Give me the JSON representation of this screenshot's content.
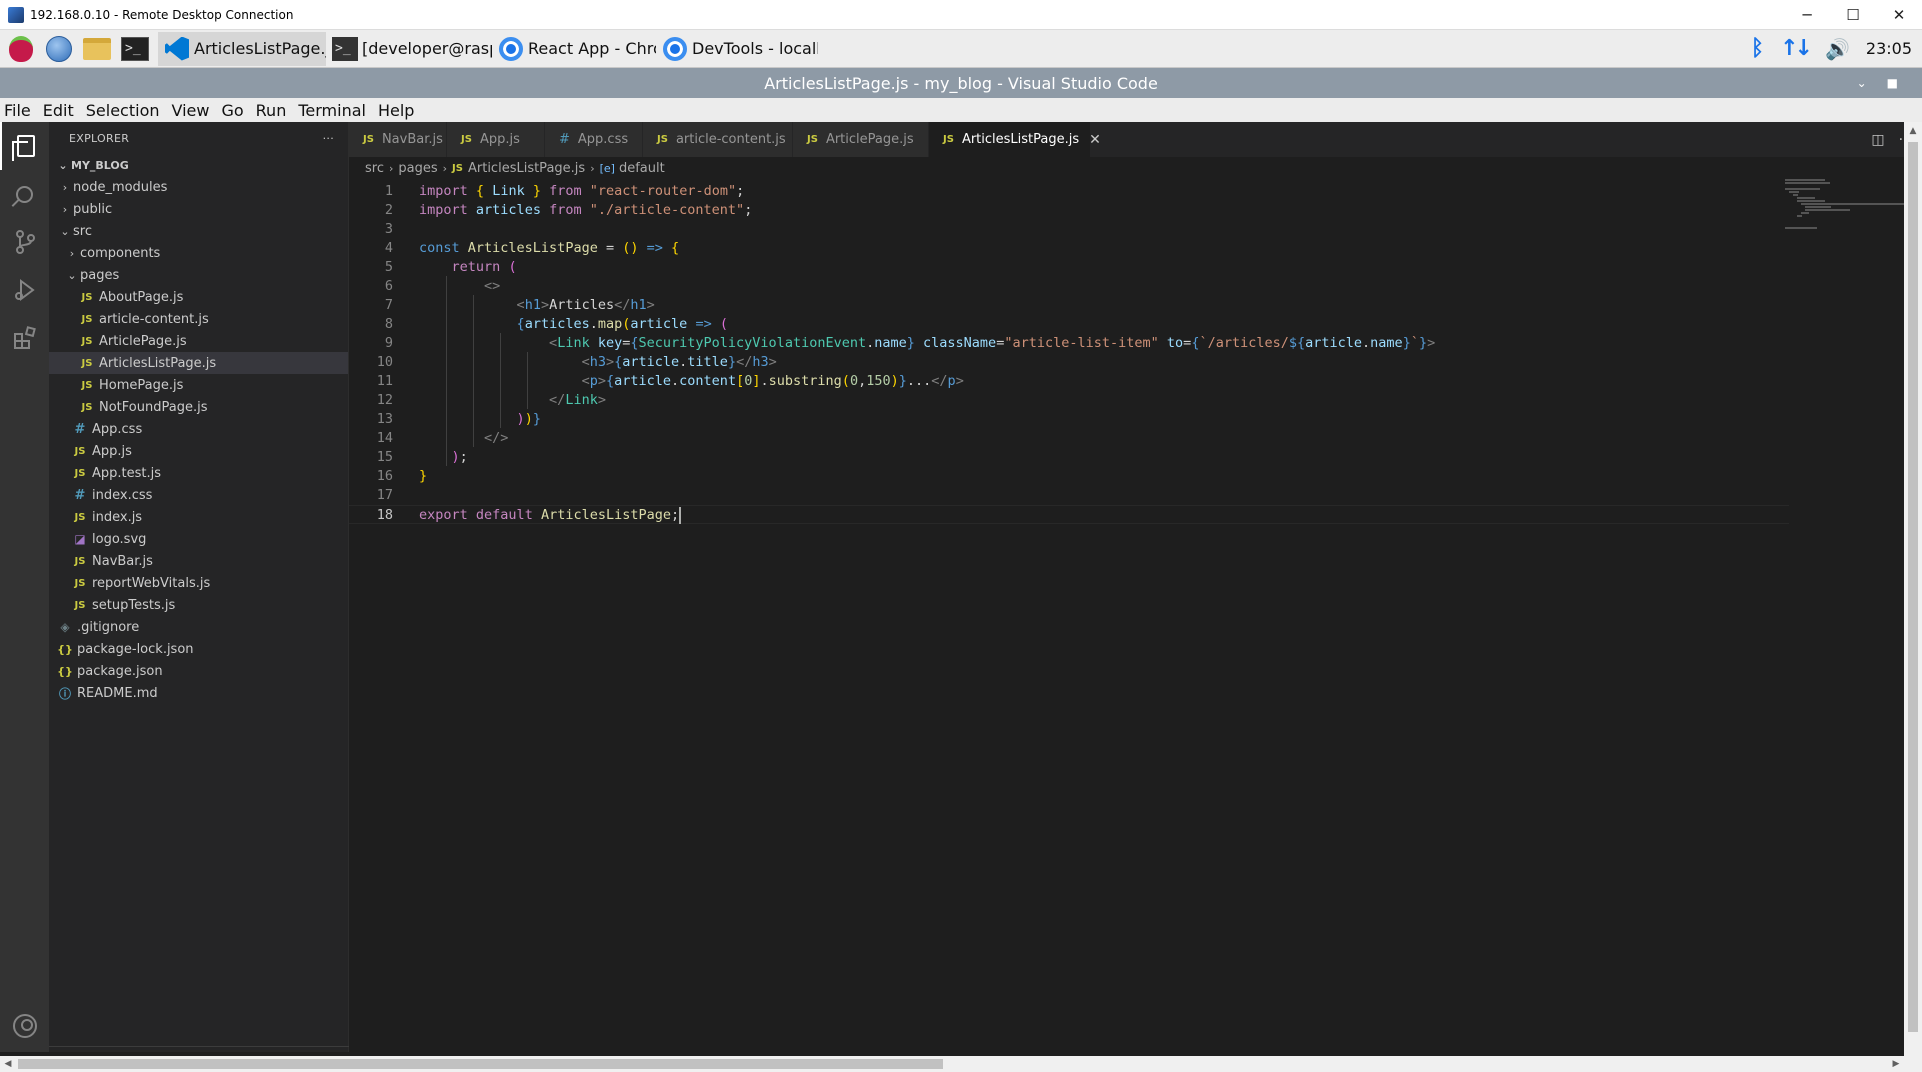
{
  "rdp": {
    "title": "192.168.0.10 - Remote Desktop Connection",
    "minimize": "─",
    "maximize": "☐",
    "close": "✕"
  },
  "taskbar": {
    "tasks": [
      {
        "label": "ArticlesListPage.js - ...",
        "icon": "vscode-icon",
        "active": true
      },
      {
        "label": "[developer@raspberr...",
        "icon": "terminal-icon",
        "active": false
      },
      {
        "label": "React App - Chromium",
        "icon": "chromium-icon",
        "active": false
      },
      {
        "label": "DevTools - localhost:...",
        "icon": "chromium-icon",
        "active": false
      }
    ],
    "clock": "23:05"
  },
  "window": {
    "title": "ArticlesListPage.js - my_blog - Visual Studio Code"
  },
  "menu": [
    "File",
    "Edit",
    "Selection",
    "View",
    "Go",
    "Run",
    "Terminal",
    "Help"
  ],
  "sidebar": {
    "title": "EXPLORER",
    "more": "···",
    "root": "MY_BLOG",
    "items": [
      {
        "label": "node_modules",
        "type": "folder",
        "open": false,
        "depth": 1
      },
      {
        "label": "public",
        "type": "folder",
        "open": false,
        "depth": 1
      },
      {
        "label": "src",
        "type": "folder",
        "open": true,
        "depth": 1
      },
      {
        "label": "components",
        "type": "folder",
        "open": false,
        "depth": 2
      },
      {
        "label": "pages",
        "type": "folder",
        "open": true,
        "depth": 2
      },
      {
        "label": "AboutPage.js",
        "type": "js",
        "depth": 3
      },
      {
        "label": "article-content.js",
        "type": "js",
        "depth": 3
      },
      {
        "label": "ArticlePage.js",
        "type": "js",
        "depth": 3
      },
      {
        "label": "ArticlesListPage.js",
        "type": "js",
        "depth": 3,
        "selected": true
      },
      {
        "label": "HomePage.js",
        "type": "js",
        "depth": 3
      },
      {
        "label": "NotFoundPage.js",
        "type": "js",
        "depth": 3
      },
      {
        "label": "App.css",
        "type": "css",
        "depth": 2
      },
      {
        "label": "App.js",
        "type": "js",
        "depth": 2
      },
      {
        "label": "App.test.js",
        "type": "js",
        "depth": 2
      },
      {
        "label": "index.css",
        "type": "css",
        "depth": 2
      },
      {
        "label": "index.js",
        "type": "js",
        "depth": 2
      },
      {
        "label": "logo.svg",
        "type": "svg",
        "depth": 2
      },
      {
        "label": "NavBar.js",
        "type": "js",
        "depth": 2
      },
      {
        "label": "reportWebVitals.js",
        "type": "js",
        "depth": 2
      },
      {
        "label": "setupTests.js",
        "type": "js",
        "depth": 2
      },
      {
        "label": ".gitignore",
        "type": "git",
        "depth": 1
      },
      {
        "label": "package-lock.json",
        "type": "json",
        "depth": 1
      },
      {
        "label": "package.json",
        "type": "json",
        "depth": 1
      },
      {
        "label": "README.md",
        "type": "md",
        "depth": 1
      }
    ]
  },
  "tabs": [
    {
      "label": "NavBar.js",
      "type": "js"
    },
    {
      "label": "App.js",
      "type": "js"
    },
    {
      "label": "App.css",
      "type": "css"
    },
    {
      "label": "article-content.js",
      "type": "js"
    },
    {
      "label": "ArticlePage.js",
      "type": "js"
    },
    {
      "label": "ArticlesListPage.js",
      "type": "js",
      "active": true
    }
  ],
  "breadcrumb": {
    "parts": [
      "src",
      "pages",
      "ArticlesListPage.js"
    ],
    "symbol": "default"
  },
  "editor": {
    "current_line": 18,
    "lines": [
      [
        [
          "kw",
          "import"
        ],
        [
          "p",
          " "
        ],
        [
          "br1",
          "{"
        ],
        [
          "p",
          " "
        ],
        [
          "var",
          "Link"
        ],
        [
          "p",
          " "
        ],
        [
          "br1",
          "}"
        ],
        [
          "p",
          " "
        ],
        [
          "kw",
          "from"
        ],
        [
          "p",
          " "
        ],
        [
          "str",
          "\"react-router-dom\""
        ],
        [
          "p",
          ";"
        ]
      ],
      [
        [
          "kw",
          "import"
        ],
        [
          "p",
          " "
        ],
        [
          "var",
          "articles"
        ],
        [
          "p",
          " "
        ],
        [
          "kw",
          "from"
        ],
        [
          "p",
          " "
        ],
        [
          "str",
          "\"./article-content\""
        ],
        [
          "p",
          ";"
        ]
      ],
      [],
      [
        [
          "kb",
          "const"
        ],
        [
          "p",
          " "
        ],
        [
          "fn",
          "ArticlesListPage"
        ],
        [
          "p",
          " = "
        ],
        [
          "br1",
          "()"
        ],
        [
          "p",
          " "
        ],
        [
          "kb",
          "=>"
        ],
        [
          "p",
          " "
        ],
        [
          "br1",
          "{"
        ]
      ],
      [
        [
          "p",
          "    "
        ],
        [
          "kw",
          "return"
        ],
        [
          "p",
          " "
        ],
        [
          "br2",
          "("
        ]
      ],
      [
        [
          "p",
          "        "
        ],
        [
          "tagb",
          "<>"
        ]
      ],
      [
        [
          "p",
          "            "
        ],
        [
          "tagb",
          "<"
        ],
        [
          "tag",
          "h1"
        ],
        [
          "tagb",
          ">"
        ],
        [
          "p",
          "Articles"
        ],
        [
          "tagb",
          "</"
        ],
        [
          "tag",
          "h1"
        ],
        [
          "tagb",
          ">"
        ]
      ],
      [
        [
          "p",
          "            "
        ],
        [
          "kb",
          "{"
        ],
        [
          "var",
          "articles"
        ],
        [
          "p",
          "."
        ],
        [
          "fn",
          "map"
        ],
        [
          "br1",
          "("
        ],
        [
          "var",
          "article"
        ],
        [
          "p",
          " "
        ],
        [
          "kb",
          "=>"
        ],
        [
          "p",
          " "
        ],
        [
          "br2",
          "("
        ]
      ],
      [
        [
          "p",
          "                "
        ],
        [
          "tagb",
          "<"
        ],
        [
          "typ",
          "Link"
        ],
        [
          "p",
          " "
        ],
        [
          "attr",
          "key"
        ],
        [
          "p",
          "="
        ],
        [
          "kb",
          "{"
        ],
        [
          "typ",
          "SecurityPolicyViolationEvent"
        ],
        [
          "p",
          "."
        ],
        [
          "var",
          "name"
        ],
        [
          "kb",
          "}"
        ],
        [
          "p",
          " "
        ],
        [
          "attr",
          "className"
        ],
        [
          "p",
          "="
        ],
        [
          "str",
          "\"article-list-item\""
        ],
        [
          "p",
          " "
        ],
        [
          "attr",
          "to"
        ],
        [
          "p",
          "="
        ],
        [
          "kb",
          "{"
        ],
        [
          "str",
          "`/articles/"
        ],
        [
          "kb",
          "${"
        ],
        [
          "var",
          "article"
        ],
        [
          "p",
          "."
        ],
        [
          "var",
          "name"
        ],
        [
          "kb",
          "}"
        ],
        [
          "str",
          "`"
        ],
        [
          "kb",
          "}"
        ],
        [
          "tagb",
          ">"
        ]
      ],
      [
        [
          "p",
          "                    "
        ],
        [
          "tagb",
          "<"
        ],
        [
          "tag",
          "h3"
        ],
        [
          "tagb",
          ">"
        ],
        [
          "kb",
          "{"
        ],
        [
          "var",
          "article"
        ],
        [
          "p",
          "."
        ],
        [
          "var",
          "title"
        ],
        [
          "kb",
          "}"
        ],
        [
          "tagb",
          "</"
        ],
        [
          "tag",
          "h3"
        ],
        [
          "tagb",
          ">"
        ]
      ],
      [
        [
          "p",
          "                    "
        ],
        [
          "tagb",
          "<"
        ],
        [
          "tag",
          "p"
        ],
        [
          "tagb",
          ">"
        ],
        [
          "kb",
          "{"
        ],
        [
          "var",
          "article"
        ],
        [
          "p",
          "."
        ],
        [
          "var",
          "content"
        ],
        [
          "br1",
          "["
        ],
        [
          "num",
          "0"
        ],
        [
          "br1",
          "]"
        ],
        [
          "p",
          "."
        ],
        [
          "fn",
          "substring"
        ],
        [
          "br1",
          "("
        ],
        [
          "num",
          "0"
        ],
        [
          "p",
          ","
        ],
        [
          "num",
          "150"
        ],
        [
          "br1",
          ")"
        ],
        [
          "kb",
          "}"
        ],
        [
          "p",
          "..."
        ],
        [
          "tagb",
          "</"
        ],
        [
          "tag",
          "p"
        ],
        [
          "tagb",
          ">"
        ]
      ],
      [
        [
          "p",
          "                "
        ],
        [
          "tagb",
          "</"
        ],
        [
          "typ",
          "Link"
        ],
        [
          "tagb",
          ">"
        ]
      ],
      [
        [
          "p",
          "            "
        ],
        [
          "br2",
          ")"
        ],
        [
          "br1",
          ")"
        ],
        [
          "kb",
          "}"
        ]
      ],
      [
        [
          "p",
          "        "
        ],
        [
          "tagb",
          "</>"
        ]
      ],
      [
        [
          "p",
          "    "
        ],
        [
          "br2",
          ")"
        ],
        [
          "p",
          ";"
        ]
      ],
      [
        [
          "br1",
          "}"
        ]
      ],
      [],
      [
        [
          "kw",
          "export"
        ],
        [
          "p",
          " "
        ],
        [
          "kw",
          "default"
        ],
        [
          "p",
          " "
        ],
        [
          "fn",
          "ArticlesListPage"
        ],
        [
          "p",
          ";"
        ]
      ]
    ]
  }
}
